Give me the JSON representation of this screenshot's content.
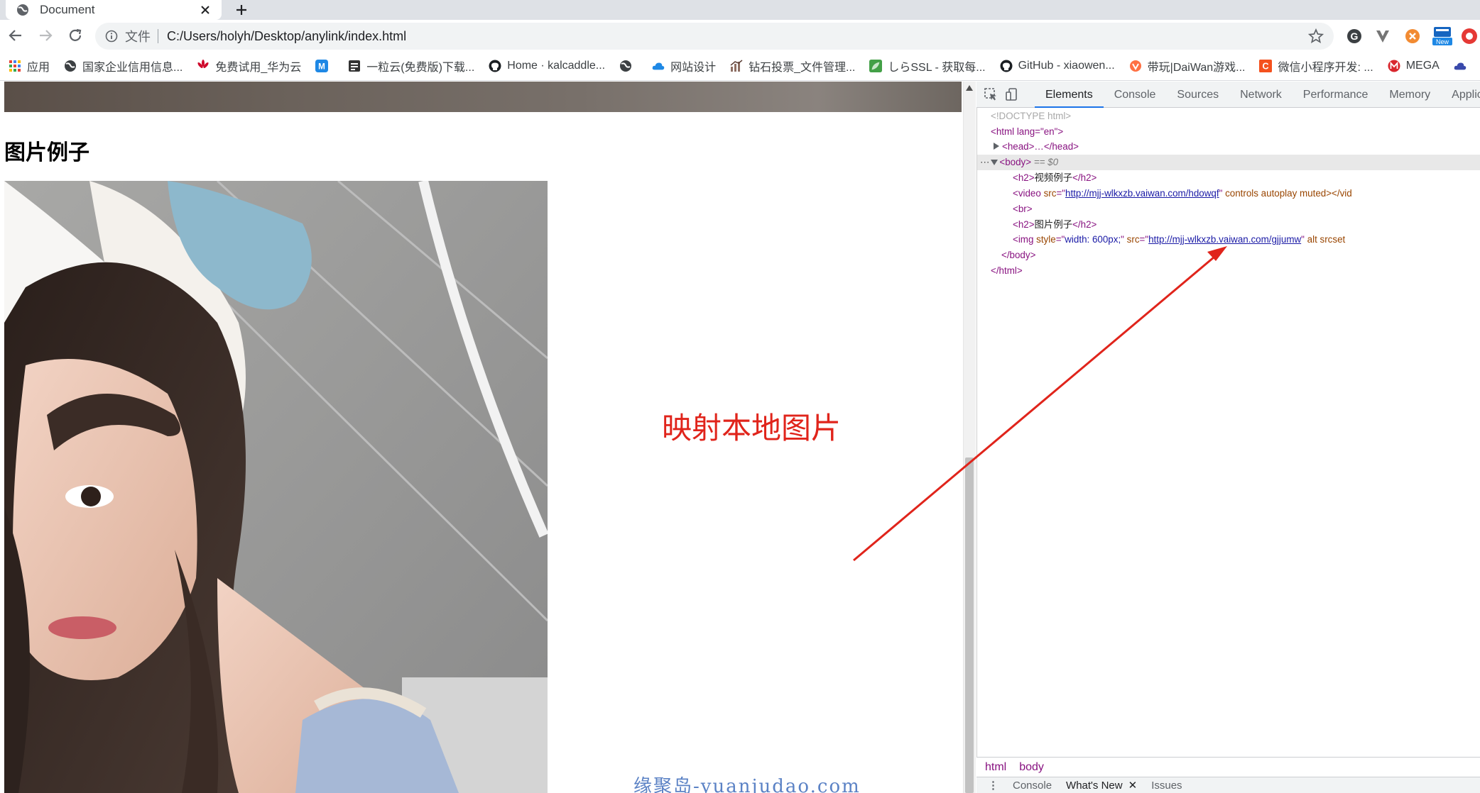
{
  "tab": {
    "title": "Document",
    "new_tab_label": "+"
  },
  "address_bar": {
    "scheme_label": "文件",
    "url": "C:/Users/holyh/Desktop/anylink/index.html"
  },
  "extension_badge": "New",
  "bookmarks": [
    {
      "label": "应用",
      "icon": "apps-grid-icon"
    },
    {
      "label": "国家企业信用信息...",
      "icon": "globe-icon"
    },
    {
      "label": "免费试用_华为云",
      "icon": "huawei-icon"
    },
    {
      "label": "",
      "icon": "m-logo-icon"
    },
    {
      "label": "一粒云(免费版)下载...",
      "icon": "doc-icon"
    },
    {
      "label": "Home · kalcaddle...",
      "icon": "github-icon"
    },
    {
      "label": "",
      "icon": "globe-icon"
    },
    {
      "label": "网站设计",
      "icon": "cloud-icon"
    },
    {
      "label": "钻石投票_文件管理...",
      "icon": "chart-icon"
    },
    {
      "label": "しらSSL - 获取每...",
      "icon": "leaf-icon"
    },
    {
      "label": "GitHub - xiaowen...",
      "icon": "github-icon"
    },
    {
      "label": "带玩|DaiWan游戏...",
      "icon": "game-icon"
    },
    {
      "label": "微信小程序开发: ...",
      "icon": "c-logo-icon"
    },
    {
      "label": "MEGA",
      "icon": "mega-icon"
    }
  ],
  "page": {
    "heading": "图片例子",
    "annotation": "映射本地图片",
    "watermark": "缘聚岛-yuanjudao.com"
  },
  "devtools": {
    "tabs": [
      "Elements",
      "Console",
      "Sources",
      "Network",
      "Performance",
      "Memory",
      "Applicati"
    ],
    "active_tab": "Elements",
    "dom": {
      "doctype": "<!DOCTYPE html>",
      "html_open": "<html lang=\"en\">",
      "head": "<head>…</head>",
      "body_open": "<body>",
      "selected_marker": "== $0",
      "h2_video": "视频例子",
      "video_src": "http://mjj-wlkxzb.vaiwan.com/hdowqf",
      "video_rest": " controls autoplay muted></vid",
      "br": "<br>",
      "h2_image": "图片例子",
      "img_style": "width: 600px;",
      "img_src": "http://mjj-wlkxzb.vaiwan.com/gjjumw",
      "img_rest": " alt srcset",
      "body_close": "</body>",
      "html_close": "</html>"
    },
    "breadcrumbs": [
      "html",
      "body"
    ],
    "drawer_tabs": [
      "Console",
      "What's New",
      "Issues"
    ]
  },
  "colors": {
    "annotation": "#e0241b",
    "watermark": "#5b82c5",
    "devtools_active_tab": "#1a73e8",
    "dom_tag": "#881280",
    "dom_attr": "#994500",
    "dom_value": "#1a1aa6"
  }
}
